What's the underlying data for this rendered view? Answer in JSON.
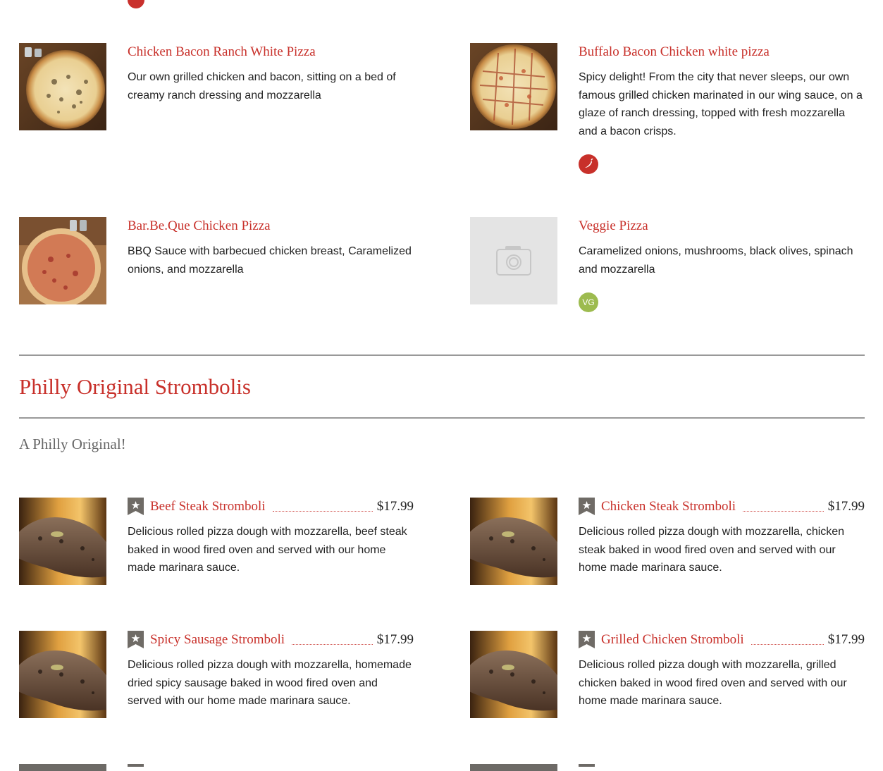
{
  "colors": {
    "accent": "#c8302a",
    "veggie": "#9dbb4f",
    "rule": "#999999",
    "muted": "#666666"
  },
  "pizzas": [
    {
      "title": "Chicken Bacon Ranch White Pizza",
      "desc": "Our own grilled chicken and bacon, sitting on a bed of creamy ranch dressing and mozzarella",
      "image": "pizza-photo"
    },
    {
      "title": "Buffalo Bacon Chicken white pizza",
      "desc": "Spicy delight! From the city that never sleeps, our own famous grilled chicken marinated in our wing sauce, on a glaze of ranch dressing, topped with fresh mozzarella and a bacon crisps.",
      "image": "pizza-photo",
      "badge": "chili-pepper-icon"
    },
    {
      "title": "Bar.Be.Que Chicken Pizza",
      "desc": "BBQ Sauce with barbecued chicken breast, Caramelized onions, and mozzarella",
      "image": "pizza-photo"
    },
    {
      "title": "Veggie Pizza",
      "desc": "Caramelized onions, mushrooms, black olives, spinach and mozzarella",
      "image": "camera-placeholder-icon",
      "badge_text": "VG"
    }
  ],
  "section": {
    "title": "Philly Original Strombolis",
    "subtitle": "A Philly Original!"
  },
  "strombolis": [
    {
      "title": "Beef Steak Stromboli",
      "price": "$17.99",
      "desc": "Delicious rolled pizza dough with mozzarella, beef steak baked in wood fired oven and served with our home made marinara sauce.",
      "image": "stromboli-photo"
    },
    {
      "title": "Chicken Steak Stromboli",
      "price": "$17.99",
      "desc": "Delicious rolled pizza dough with mozzarella, chicken steak baked in wood fired oven and served with our home made marinara sauce.",
      "image": "stromboli-photo"
    },
    {
      "title": "Spicy Sausage Stromboli",
      "price": "$17.99",
      "desc": "Delicious rolled pizza dough with mozzarella, homemade dried spicy sausage baked in wood fired oven and served with our home made marinara sauce.",
      "image": "stromboli-photo"
    },
    {
      "title": "Grilled Chicken Stromboli",
      "price": "$17.99",
      "desc": "Delicious rolled pizza dough with mozzarella, grilled chicken baked in wood fired oven and served with our home made marinara sauce.",
      "image": "stromboli-photo"
    }
  ]
}
